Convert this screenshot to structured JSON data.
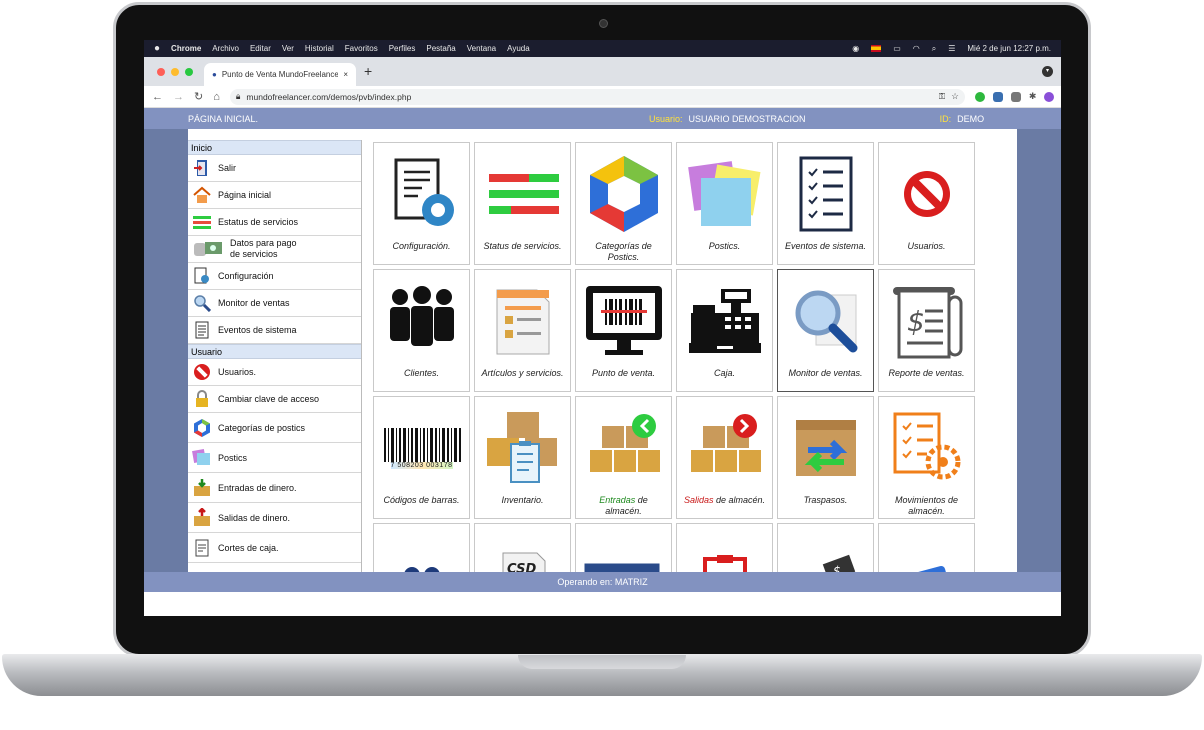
{
  "menubar": {
    "apple": "",
    "app": "Chrome",
    "items": [
      "Archivo",
      "Editar",
      "Ver",
      "Historial",
      "Favoritos",
      "Perfiles",
      "Pestaña",
      "Ventana",
      "Ayuda"
    ],
    "datetime": "Mié 2 de jun  12:27 p.m."
  },
  "browser": {
    "tab_title": "Punto de Venta MundoFreelancer",
    "tab_close": "×",
    "new_tab": "+",
    "url": "mundofreelancer.com/demos/pvb/index.php"
  },
  "header": {
    "page": "PÁGINA INICIAL.",
    "user_label": "Usuario:",
    "user_value": "USUARIO DEMOSTRACION",
    "id_label": "ID:",
    "id_value": "DEMO"
  },
  "sidebar": {
    "inicio_title": "Inicio",
    "inicio": [
      {
        "label": "Salir",
        "icon": "exit-door-icon"
      },
      {
        "label": "Página inicial",
        "icon": "home-icon"
      },
      {
        "label": "Estatus de servicios",
        "icon": "status-bars-icon"
      },
      {
        "label": "Datos para pago\nde servicios",
        "icon": "money-icon"
      },
      {
        "label": "Configuración",
        "icon": "config-icon"
      },
      {
        "label": "Monitor de ventas",
        "icon": "magnifier-icon"
      },
      {
        "label": "Eventos de sistema",
        "icon": "list-icon"
      }
    ],
    "usuario_title": "Usuario",
    "usuario": [
      {
        "label": "Usuarios.",
        "icon": "forbidden-icon"
      },
      {
        "label": "Cambiar clave de acceso",
        "icon": "lock-icon"
      },
      {
        "label": "Categorías de postics",
        "icon": "hexagon-icon"
      },
      {
        "label": "Postics",
        "icon": "sticky-notes-icon"
      },
      {
        "label": "Entradas de dinero.",
        "icon": "money-in-icon"
      },
      {
        "label": "Salidas de dinero.",
        "icon": "money-out-icon"
      },
      {
        "label": "Cortes de caja.",
        "icon": "cash-cut-icon"
      }
    ]
  },
  "tiles": [
    {
      "label": "Configuración.",
      "icon": "config-document-icon"
    },
    {
      "label": "Status de servicios.",
      "icon": "status-bars-icon"
    },
    {
      "label": "Categorías de Postics.",
      "icon": "hexagon-icon"
    },
    {
      "label": "Postics.",
      "icon": "sticky-notes-icon"
    },
    {
      "label": "Eventos de sistema.",
      "icon": "checklist-icon"
    },
    {
      "label": "Usuarios.",
      "icon": "forbidden-icon"
    },
    {
      "label": "Clientes.",
      "icon": "people-icon"
    },
    {
      "label": "Artículos y servicios.",
      "icon": "items-document-icon"
    },
    {
      "label": "Punto de venta.",
      "icon": "barcode-monitor-icon"
    },
    {
      "label": "Caja.",
      "icon": "cash-register-icon"
    },
    {
      "label": "Monitor de ventas.",
      "icon": "magnifier-icon"
    },
    {
      "label": "Reporte de ventas.",
      "icon": "sales-report-icon"
    },
    {
      "label": "Códigos de barras.",
      "icon": "barcode-icon",
      "barcode": "7 508203 003178"
    },
    {
      "label": "Inventario.",
      "icon": "boxes-clipboard-icon"
    },
    {
      "label_a": "Entradas",
      "label_b": " de almacén.",
      "icon": "boxes-in-icon"
    },
    {
      "label_a": "Salidas",
      "label_b": " de almacén.",
      "icon": "boxes-out-icon"
    },
    {
      "label": "Traspasos.",
      "icon": "box-transfer-icon"
    },
    {
      "label": "Movimientos de almacén.",
      "icon": "warehouse-moves-icon"
    },
    {
      "label": "",
      "icon": "spheres-icon"
    },
    {
      "label": "",
      "icon": "csd-icon",
      "badge": "CSD"
    },
    {
      "label": "",
      "icon": "id-card-icon"
    },
    {
      "label": "",
      "icon": "red-clipboard-icon"
    },
    {
      "label": "",
      "icon": "payment-hand-icon"
    },
    {
      "label": "",
      "icon": "cards-icon"
    }
  ],
  "footer": {
    "operating": "Operando en: MATRIZ"
  },
  "colors": {
    "header_bg": "#8292c0",
    "frame_bg": "#6a7ba4",
    "label_yellow": "#ffe23a",
    "entradas": "#1f8a1f",
    "salidas": "#c81818"
  }
}
